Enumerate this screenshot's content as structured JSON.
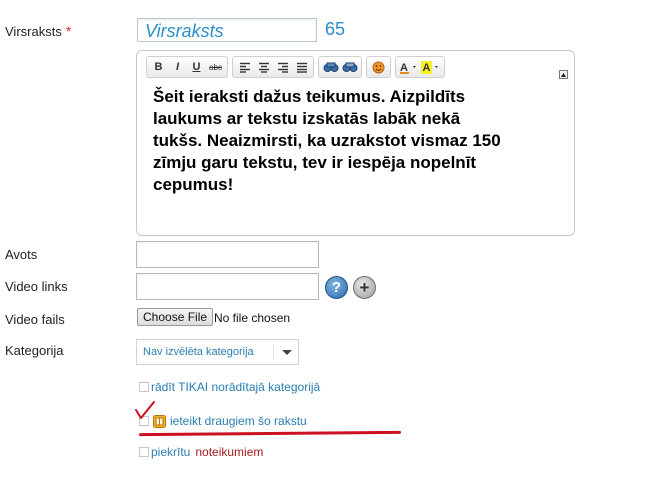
{
  "form": {
    "title_label": "Virsraksts",
    "required_marker": "*",
    "title_value": "Virsraksts",
    "char_counter": "65",
    "editor_text": "Šeit ieraksti dažus teikumus. Aizpildīts laukums ar tekstu izskatās labāk nekā tukšs. Neaizmirsti, ka uzrakstot vismaz 150 zīmju garu tekstu, tev ir iespēja nopelnīt cepumus!",
    "source_label": "Avots",
    "source_value": "",
    "video_link_label": "Video links",
    "video_link_value": "",
    "video_file_label": "Video fails",
    "choose_file_label": "Choose File",
    "no_file_text": "No file chosen",
    "category_label": "Kategorija",
    "category_selected": "Nav izvēlēta kategorija",
    "show_only_category_label": "rādīt TIKAI norādītajā kategorijā",
    "recommend_friends_label": "ieteikt draugiem šo rakstu",
    "agree_prefix": "piekrītu",
    "agree_terms_link": "noteikumiem"
  },
  "toolbar": {
    "bold": "B",
    "italic": "I",
    "underline": "U",
    "strikethrough": "abc"
  },
  "colors": {
    "accent": "#2a8fc9",
    "required": "#d9262c",
    "annotation_red": "#cc1122",
    "terms_link": "#a31b21"
  },
  "icons": [
    "align-left-icon",
    "align-center-icon",
    "align-right-icon",
    "align-justify-icon",
    "link-icon",
    "unlink-icon",
    "smiley-icon",
    "font-color-icon",
    "highlight-color-icon",
    "help-icon",
    "add-icon",
    "gift-icon",
    "checkmark-annotation-icon"
  ]
}
